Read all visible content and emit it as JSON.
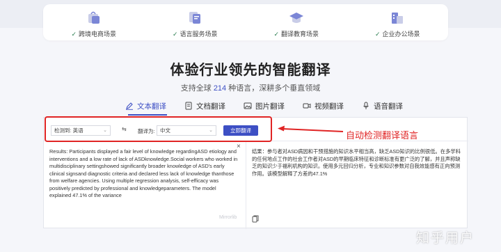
{
  "scenes": [
    {
      "label": "跨境电商场景",
      "icon": "shopping-bag-icon"
    },
    {
      "label": "语言服务场景",
      "icon": "document-translate-icon"
    },
    {
      "label": "翻译教育场景",
      "icon": "graduation-cap-icon"
    },
    {
      "label": "企业办公场景",
      "icon": "office-building-icon"
    }
  ],
  "hero": {
    "title": "体验行业领先的智能翻译",
    "subtitle_prefix": "支持全球 ",
    "subtitle_count": "214",
    "subtitle_suffix": " 种语言，深耕多个垂直领域"
  },
  "tabs": [
    {
      "label": "文本翻译",
      "icon": "pen-icon",
      "active": true
    },
    {
      "label": "文档翻译",
      "icon": "document-icon",
      "active": false
    },
    {
      "label": "图片翻译",
      "icon": "image-icon",
      "active": false
    },
    {
      "label": "视频翻译",
      "icon": "video-icon",
      "active": false
    },
    {
      "label": "语音翻译",
      "icon": "microphone-icon",
      "active": false
    }
  ],
  "toolbar": {
    "source_lang_value": "检测到: 英语",
    "swap_glyph": "⇆",
    "target_label": "翻译为:",
    "target_lang_value": "中文",
    "translate_button": "立即翻译"
  },
  "source_text": "Results: Participants displayed a fair level of knowledge regardingASD etiology and interventions and a low rate of lack of ASDknowledge.Social workers who worked in multidisciplinary settingshowed significantly broader knowledge of ASD's early clinical signsand diagnostic criteria and declared less lack of knowledge thanthose from welfare agencies. Using multiple regression analysis, self-efficacy was positively predicted by professional and knowledgeparameters. The model explained 47.1% of the variance",
  "source_watermark": "Mirrorlib",
  "target_text": "结果：参与者对ASD病因和干预措施的知识水平相当高，缺乏ASD知识的比例很低。在多学科的任何地点工作的社会工作者对ASD的早期临床特征和诊断标准有更广泛的了解，并且声称缺乏的知识少于福利机构的知识。使用多元回归分析，专业和知识参数对自我效能感有正向预测作用。该模型解释了方差的47.1%",
  "annotation": "自动检测翻译语言",
  "site_watermark": "知乎用户",
  "colors": {
    "accent": "#3d4fc4",
    "annotation_red": "#e02424"
  }
}
